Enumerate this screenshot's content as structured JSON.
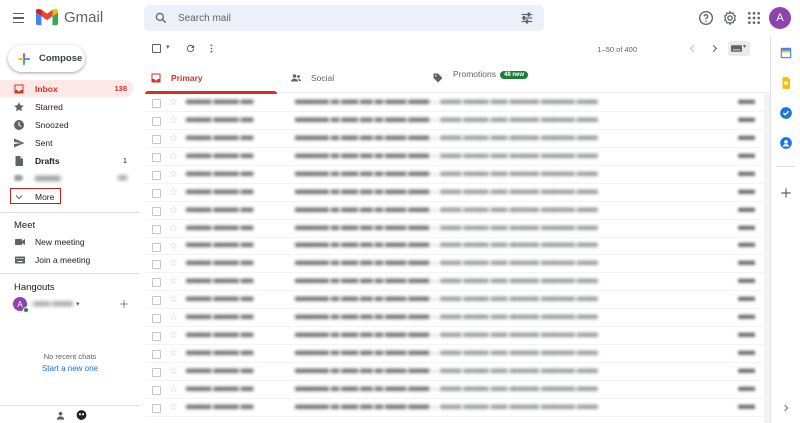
{
  "app": {
    "name": "Gmail",
    "avatar_letter": "A",
    "colors": {
      "accent": "#d93025",
      "inbox_bg": "#fce8e6",
      "link": "#1a73e8",
      "new_badge": "#188038",
      "avatar": "#8e44ad"
    }
  },
  "search": {
    "placeholder": "Search mail"
  },
  "compose": {
    "label": "Compose"
  },
  "nav": [
    {
      "label": "Inbox",
      "count": "138",
      "icon": "inbox-icon",
      "active": true
    },
    {
      "label": "Starred",
      "count": "",
      "icon": "star-icon"
    },
    {
      "label": "Snoozed",
      "count": "",
      "icon": "clock-icon"
    },
    {
      "label": "Sent",
      "count": "",
      "icon": "send-icon"
    },
    {
      "label": "Drafts",
      "count": "1",
      "icon": "draft-icon",
      "bold": true
    },
    {
      "label": "More",
      "count": "",
      "icon": "chevron-down-icon"
    }
  ],
  "meet": {
    "title": "Meet",
    "items": [
      {
        "label": "New meeting",
        "icon": "video-icon"
      },
      {
        "label": "Join a meeting",
        "icon": "keyboard-icon"
      }
    ]
  },
  "hangouts": {
    "title": "Hangouts",
    "avatar_letter": "A",
    "no_chats": "No recent chats",
    "start_new": "Start a new one"
  },
  "toolbar": {
    "pager": "1–50 of 400"
  },
  "tabs": [
    {
      "label": "Primary",
      "icon": "inbox-icon",
      "active": true
    },
    {
      "label": "Social",
      "icon": "people-icon"
    },
    {
      "label": "Promotions",
      "icon": "tag-icon",
      "badge": "48 new"
    }
  ]
}
